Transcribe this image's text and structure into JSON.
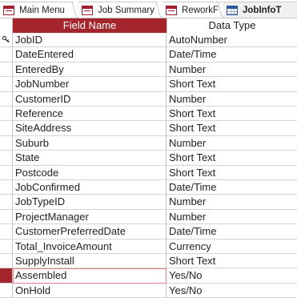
{
  "tabs": [
    {
      "label": "Main Menu",
      "icon": "form-icon",
      "active": false
    },
    {
      "label": "Job Summary",
      "icon": "form-icon",
      "active": false
    },
    {
      "label": "ReworkF",
      "icon": "form-icon",
      "active": false
    },
    {
      "label": "JobInfoT",
      "icon": "table-icon",
      "active": true
    }
  ],
  "grid": {
    "headers": {
      "field_name": "Field Name",
      "data_type": "Data Type"
    },
    "rows": [
      {
        "field": "JobID",
        "type": "AutoNumber",
        "primary_key": true
      },
      {
        "field": "DateEntered",
        "type": "Date/Time"
      },
      {
        "field": "EnteredBy",
        "type": "Number"
      },
      {
        "field": "JobNumber",
        "type": "Short Text"
      },
      {
        "field": "CustomerID",
        "type": "Number"
      },
      {
        "field": "Reference",
        "type": "Short Text"
      },
      {
        "field": "SiteAddress",
        "type": "Short Text"
      },
      {
        "field": "Suburb",
        "type": "Number"
      },
      {
        "field": "State",
        "type": "Short Text"
      },
      {
        "field": "Postcode",
        "type": "Short Text"
      },
      {
        "field": "JobConfirmed",
        "type": "Date/Time"
      },
      {
        "field": "JobTypeID",
        "type": "Number"
      },
      {
        "field": "ProjectManager",
        "type": "Number"
      },
      {
        "field": "CustomerPreferredDate",
        "type": "Date/Time"
      },
      {
        "field": "Total_InvoiceAmount",
        "type": "Currency"
      },
      {
        "field": "SupplyInstall",
        "type": "Short Text"
      },
      {
        "field": "Assembled",
        "type": "Yes/No",
        "current": true
      },
      {
        "field": "OnHold",
        "type": "Yes/No"
      }
    ]
  },
  "colors": {
    "accent": "#a4262c",
    "table_icon": "#2b579a"
  }
}
